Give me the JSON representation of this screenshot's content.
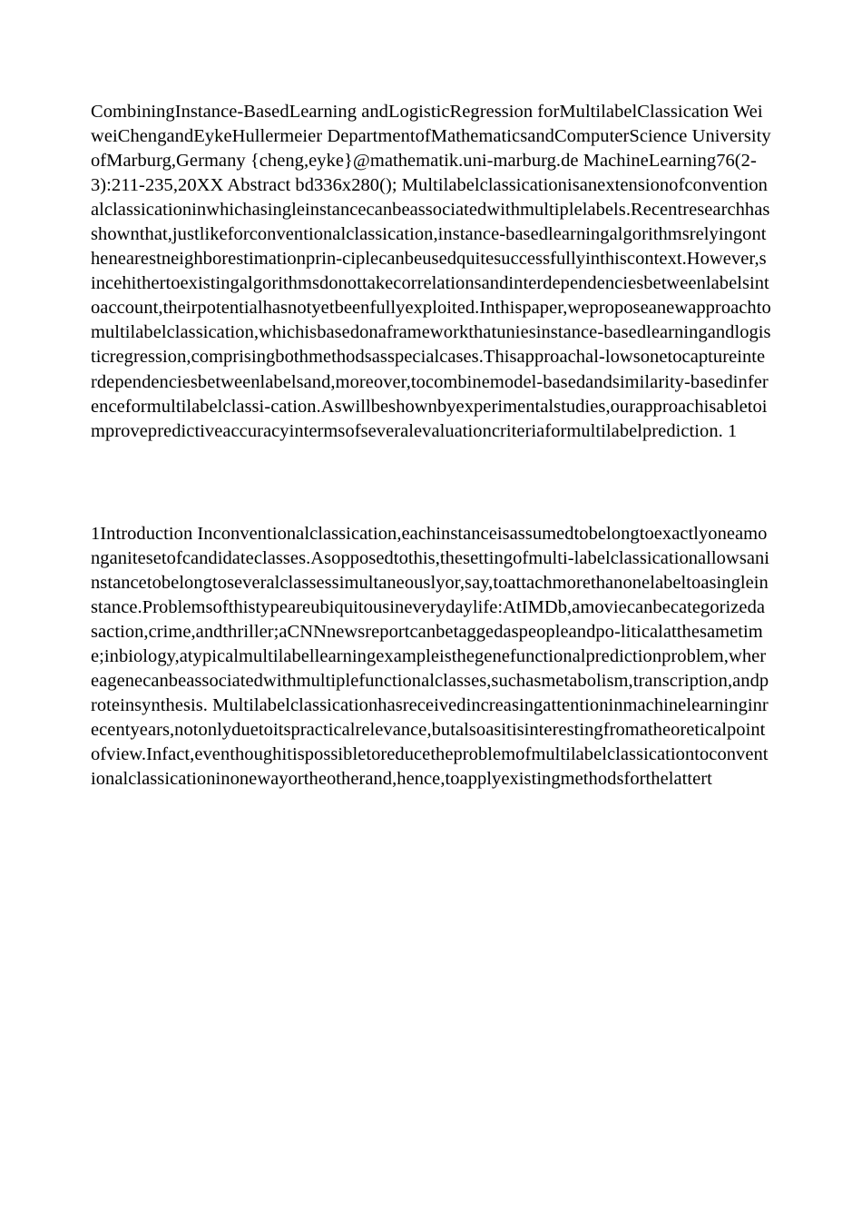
{
  "header_block": "CombiningInstance-BasedLearning\nandLogisticRegression\nforMultilabelClassi\u0001cation\nWeiweiChengandEykeHullermeier\nDepartmentofMathematicsandComputerScience\nUniversityofMarburg,Germany\n{cheng,eyke}@mathematik.uni-marburg.de\nMachineLearning76(2-3):211-235,20XX\nAbstract\nbd336x280();\nMultilabelclassi\u0001cationisanextensionofconventionalclassi\u0001cationinwhichasingleinstancecanbeassociatedwithmultiplelabels.Recentresearchhasshownthat,justlikeforconventionalclassi\u0001cation,instance-basedlearningalgorithmsrelyingonthenearestneighborestimationprin-ciplecanbeusedquitesuccessfullyinthiscontext.However,sincehithertoexistingalgorithmsdonottakecorrelationsandinterdependenciesbetweenlabelsintoaccount,theirpotentialhasnotyetbeenfullyexploited.Inthispaper,weproposeanewapproachtomultilabelclassi\u0001cation,whichisbasedonaframeworkthatuni\u0001esinstance-basedlearningandlogisticregression,comprisingbothmethodsasspecialcases.Thisapproachal-lowsonetocaptureinterdependenciesbetweenlabelsand,moreover,tocombinemodel-basedandsimilarity-basedinferenceformultilabelclassi\u0001-cation.Aswillbeshownbyexperimentalstudies,ourapproachisabletoimprovepredictiveaccuracyintermsofseveralevaluationcriteriaformultilabelprediction.\n1",
  "intro_block": "1Introduction\nInconventionalclassi\u0001cation,eachinstanceisassumedtobelongtoexactlyoneamonga\u0001nitesetofcandidateclasses.Asopposedtothis,thesettingofmulti-labelclassi\u0001cationallowsaninstancetobelongtoseveralclassessimultaneouslyor,say,toattachmorethanonelabeltoasingleinstance.Problemsofthistypeareubiquitousineverydaylife:AtIMDb,amoviecanbecategorizedasaction,crime,andthriller;aCNNnewsreportcanbetaggedaspeopleandpo-liticalatthesametime;inbiology,atypicalmultilabellearningexampleisthegenefunctionalpredictionproblem,whereagenecanbeassociatedwithmultiplefunctionalclasses,suchasmetabolism,transcription,andproteinsynthesis.\nMultilabelclassi\u0001cationhasreceivedincreasingattentioninmachinelearninginrecentyears,notonlyduetoitspracticalrelevance,butalsoasitisinterestingfromatheoreticalpointofview.Infact,eventhoughitispossibletoreducetheproblemofmultilabelclassi\u0001cationtoconventionalclassi\u0001cationinonewayortheotherand,hence,toapplyexistingmethodsforthelattert"
}
